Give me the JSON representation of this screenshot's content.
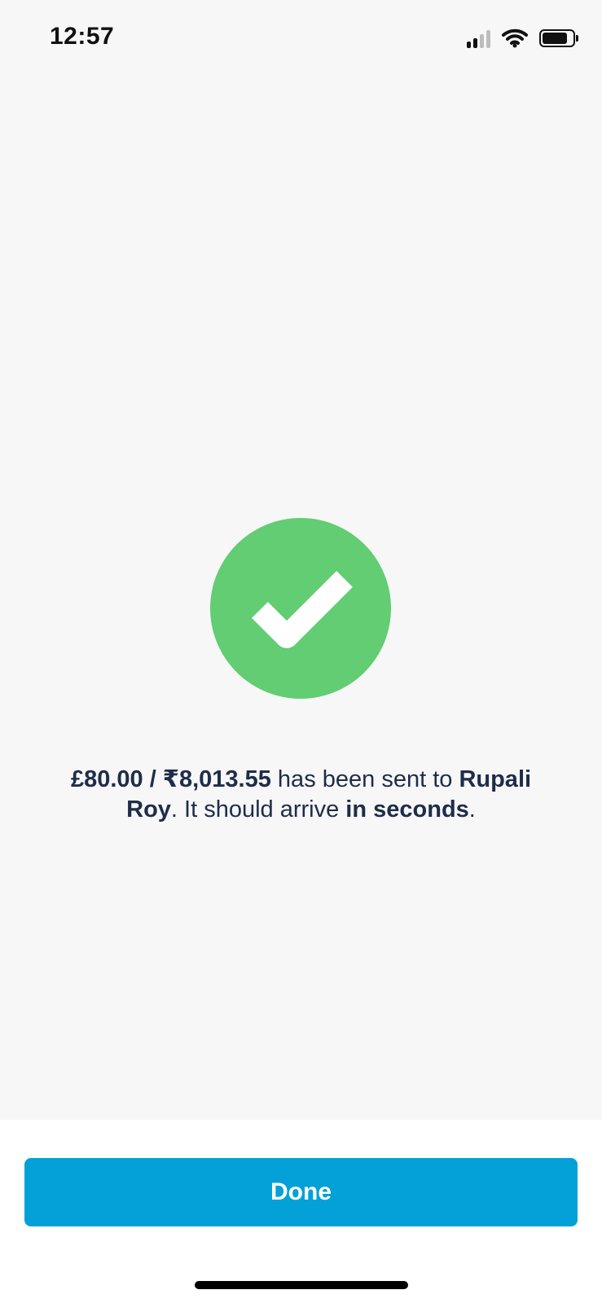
{
  "status_bar": {
    "time": "12:57",
    "icons": [
      "signal-icon",
      "wifi-icon",
      "battery-icon"
    ]
  },
  "success": {
    "icon": "check-circle-icon",
    "amount": "£80.00 / ₹8,013.55",
    "sent_text": " has been sent to ",
    "recipient": "Rupali Roy",
    "arrival_text": ". It should arrive ",
    "arrival_time": "in seconds",
    "end_punctuation": "."
  },
  "actions": {
    "done_label": "Done"
  },
  "colors": {
    "success": "#62cd72",
    "primary": "#04a1d8",
    "background": "#f7f7f7"
  }
}
